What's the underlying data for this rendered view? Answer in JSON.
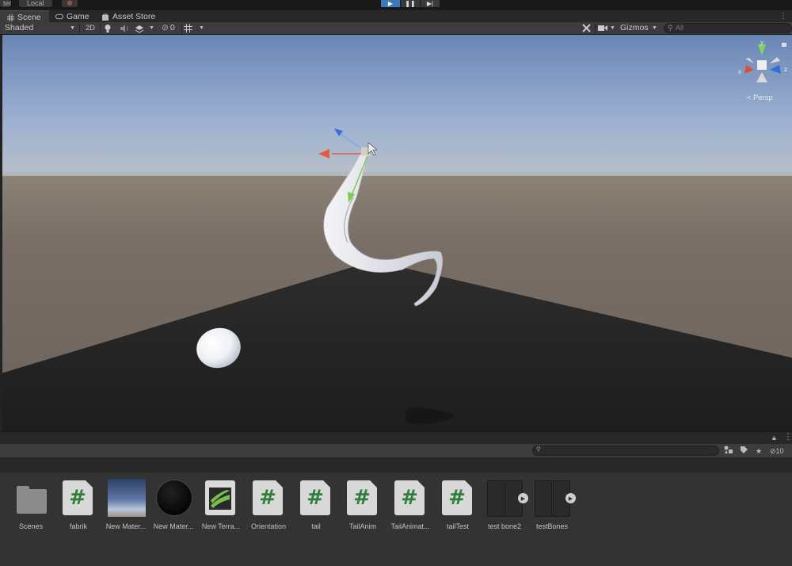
{
  "topbar": {
    "left_label": "ter",
    "pivot_label": "Local",
    "play_icons": [
      "play-icon",
      "pause-icon",
      "step-icon"
    ]
  },
  "tabs": [
    {
      "label": "Scene",
      "icon": "grid-icon",
      "active": true
    },
    {
      "label": "Game",
      "icon": "gamepad-icon",
      "active": false
    },
    {
      "label": "Asset Store",
      "icon": "bag-icon",
      "active": false
    }
  ],
  "toolbar": {
    "draw_mode": "Shaded",
    "mode_2d": "2D",
    "hidden_count": "0",
    "gizmos_label": "Gizmos",
    "search_placeholder": "All"
  },
  "viewport": {
    "projection_label": "Persp",
    "axis_labels": {
      "x": "x",
      "y": "y",
      "z": "z"
    }
  },
  "project": {
    "hidden_count": "10",
    "assets": [
      {
        "label": "Scenes",
        "type": "folder"
      },
      {
        "label": "fabrik",
        "type": "script"
      },
      {
        "label": "New Mater...",
        "type": "material-sky"
      },
      {
        "label": "New Mater...",
        "type": "material-black"
      },
      {
        "label": "New Terra...",
        "type": "terrain"
      },
      {
        "label": "Orientation",
        "type": "script"
      },
      {
        "label": "tail",
        "type": "script"
      },
      {
        "label": "TailAnim",
        "type": "script"
      },
      {
        "label": "TailAnimat...",
        "type": "script"
      },
      {
        "label": "tailTest",
        "type": "script"
      },
      {
        "label": "test bone2",
        "type": "prefab"
      },
      {
        "label": "testBones",
        "type": "prefab"
      }
    ]
  },
  "colors": {
    "accent": "#3a79bb",
    "script_hash": "#2f7f3b",
    "panel": "#3c3c3c"
  }
}
